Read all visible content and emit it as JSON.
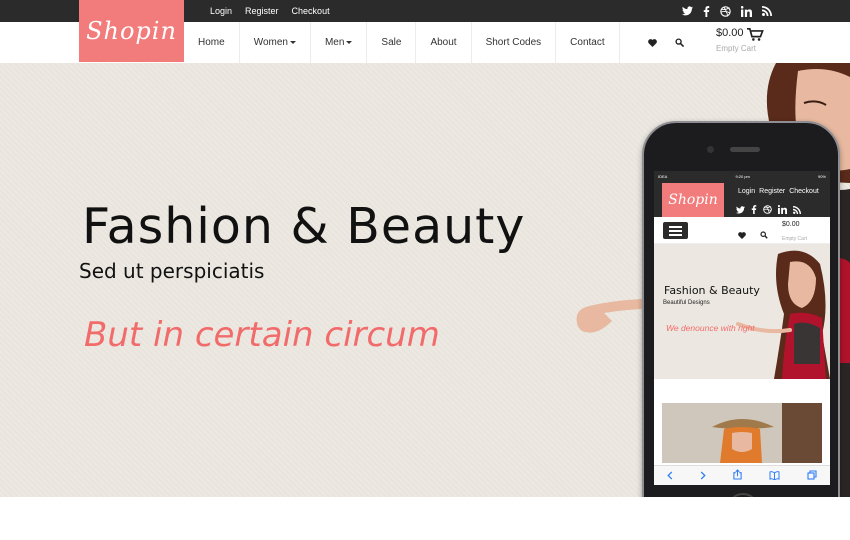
{
  "brand": {
    "logo_text": "Shopin",
    "accent_color": "#f27c7c",
    "dark_color": "#2b2b2b"
  },
  "topbar": {
    "links": [
      "Login",
      "Register",
      "Checkout"
    ],
    "social_icons": [
      "twitter-icon",
      "facebook-icon",
      "dribbble-icon",
      "linkedin-icon",
      "rss-icon"
    ]
  },
  "nav": {
    "items": [
      {
        "label": "Home",
        "dropdown": false
      },
      {
        "label": "Women",
        "dropdown": true
      },
      {
        "label": "Men",
        "dropdown": true
      },
      {
        "label": "Sale",
        "dropdown": false
      },
      {
        "label": "About",
        "dropdown": false
      },
      {
        "label": "Short Codes",
        "dropdown": false
      },
      {
        "label": "Contact",
        "dropdown": false
      }
    ],
    "tools": [
      "heart-icon",
      "search-icon"
    ]
  },
  "cart": {
    "price": "$0.00",
    "status": "Empty Cart",
    "icon": "cart-icon"
  },
  "hero": {
    "title": "Fashion & Beauty",
    "subtitle": "Sed ut perspiciatis",
    "tagline": "But in certain circum",
    "tagline_color": "#f26b6b"
  },
  "phone": {
    "status_carrier": "IDEA",
    "status_time": "9:20 pm",
    "status_battery": "90%",
    "logo_text": "Shopin",
    "links": [
      "Login",
      "Register",
      "Checkout"
    ],
    "cart_price": "$0.00",
    "cart_status": "Empty Cart",
    "hero_title": "Fashion & Beauty",
    "hero_subtitle": "Beautiful Designs",
    "hero_tagline": "We denounce with right"
  }
}
